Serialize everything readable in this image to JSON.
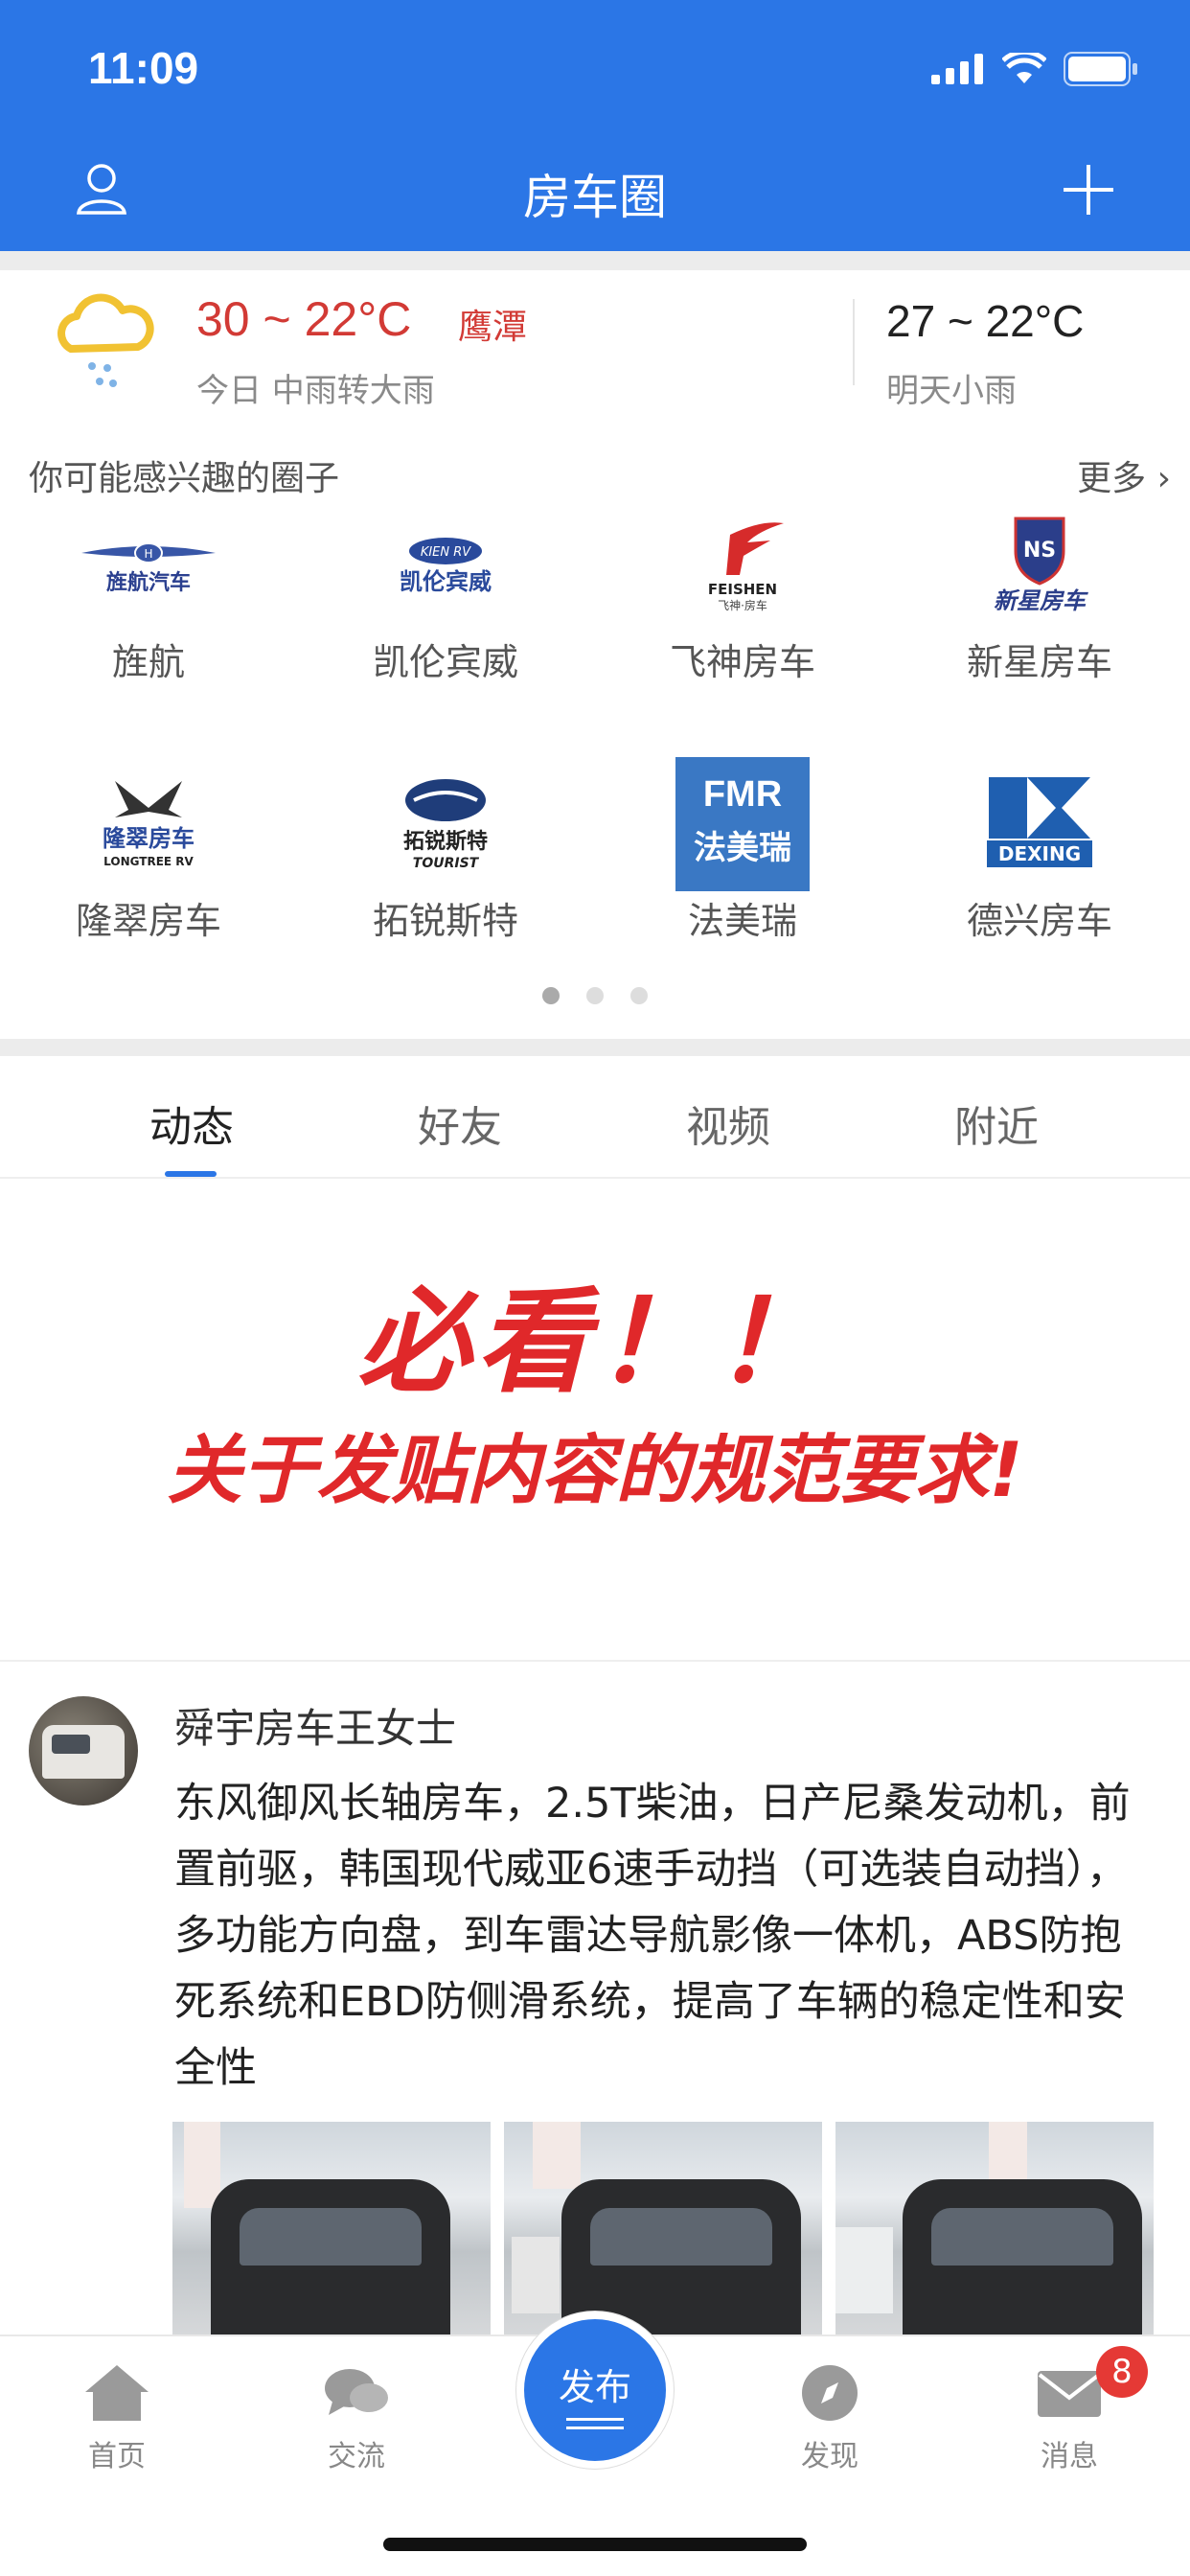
{
  "status_bar": {
    "time": "11:09"
  },
  "header": {
    "title": "房车圈"
  },
  "weather": {
    "today_temp": "30 ~ 22°C",
    "city": "鹰潭",
    "today_desc": "今日 中雨转大雨",
    "tomorrow_temp": "27 ~ 22°C",
    "tomorrow_desc": "明天小雨"
  },
  "circles": {
    "heading": "你可能感兴趣的圈子",
    "more": "更多 ›",
    "items": [
      {
        "name": "旌航",
        "logo_text": "旌航汽车"
      },
      {
        "name": "凯伦宾威",
        "logo_text": "凯伦宾威"
      },
      {
        "name": "飞神房车",
        "logo_text": "FEISHEN"
      },
      {
        "name": "新星房车",
        "logo_text": "新星房车"
      },
      {
        "name": "隆翠房车",
        "logo_text": "隆翠房车"
      },
      {
        "name": "拓锐斯特",
        "logo_text": "拓锐斯特"
      },
      {
        "name": "法美瑞",
        "logo_text": "法美瑞"
      },
      {
        "name": "德兴房车",
        "logo_text": "DEXING"
      }
    ]
  },
  "tabs": [
    "动态",
    "好友",
    "视频",
    "附近"
  ],
  "banner": {
    "line1": "必看！！",
    "line2": "关于发贴内容的规范要求!"
  },
  "post": {
    "author": "舜宇房车王女士",
    "text": "东风御风长轴房车，2.5T柴油，日产尼桑发动机，前置前驱，韩国现代威亚6速手动挡（可选装自动挡），多功能方向盘，到车雷达导航影像一体机，ABS防抱死系统和EBD防侧滑系统，提高了车辆的稳定性和安全性"
  },
  "tabbar": {
    "home": "首页",
    "chat": "交流",
    "publish": "发布",
    "discover": "发现",
    "messages": "消息",
    "badge": "8"
  },
  "colors": {
    "primary": "#2b76e6",
    "accent_red": "#d23a35"
  }
}
